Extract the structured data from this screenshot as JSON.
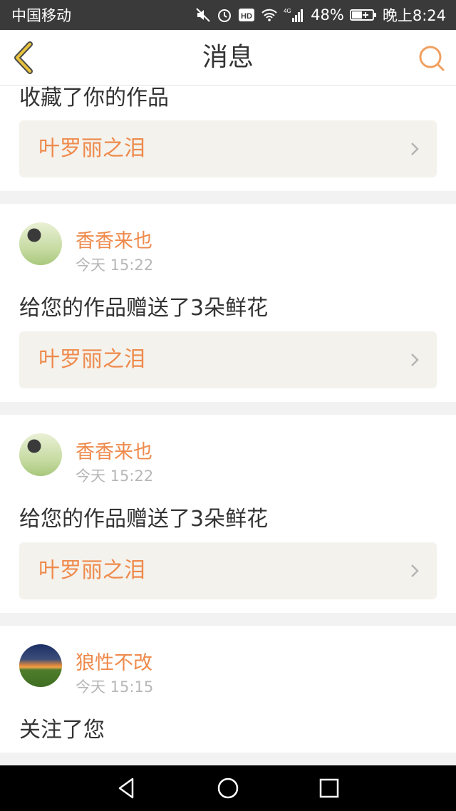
{
  "status_bar": {
    "carrier": "中国移动",
    "battery_percent": "48%",
    "network": "4G",
    "hd_badge": "HD",
    "time": "晚上8:24",
    "icons": [
      "mute-icon",
      "alarm-icon",
      "hd-icon",
      "wifi-icon",
      "signal-icon",
      "battery-icon"
    ]
  },
  "header": {
    "title": "消息",
    "back_icon": "chevron-left-icon",
    "search_icon": "search-icon",
    "accent_color": "#e8a13c"
  },
  "messages": [
    {
      "text": "收藏了你的作品",
      "work_title": "叶罗丽之泪"
    },
    {
      "username": "香香来也",
      "time": "今天 15:22",
      "text": "给您的作品赠送了3朵鲜花",
      "work_title": "叶罗丽之泪",
      "avatar": "girl-photo"
    },
    {
      "username": "香香来也",
      "time": "今天 15:22",
      "text": "给您的作品赠送了3朵鲜花",
      "work_title": "叶罗丽之泪",
      "avatar": "girl-photo"
    },
    {
      "username": "狼性不改",
      "time": "今天 15:15",
      "text": "关注了您",
      "avatar": "sunset-photo"
    }
  ],
  "system_nav": {
    "icons": [
      "back-triangle-icon",
      "home-circle-icon",
      "recents-square-icon"
    ]
  },
  "colors": {
    "name_orange": "#ee8a4c",
    "link_box_bg": "#f4f2ec",
    "divider_bg": "#f2f2f2"
  }
}
